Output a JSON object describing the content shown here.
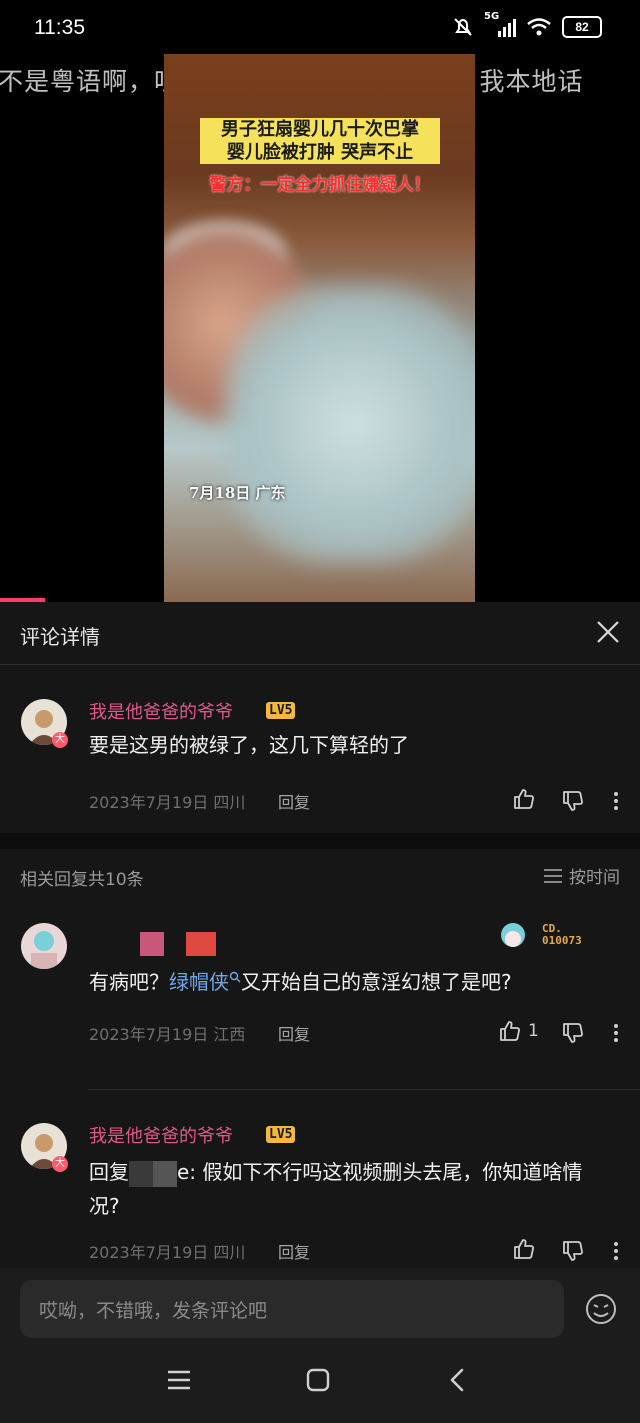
{
  "status_bar": {
    "time": "11:35",
    "signal_label": "5G",
    "battery": "82"
  },
  "danmaku": "不是粤语啊，听不懂别乱说行不行大哥。。我本地话",
  "video": {
    "caption_line1": "男子狂扇婴儿几十次巴掌",
    "caption_line2": "婴儿脸被打肿 哭声不止",
    "caption_police": "警方：一定全力抓住嫌疑人！",
    "dateline": "7月18日 广东"
  },
  "panel": {
    "title": "评论详情"
  },
  "main_comment": {
    "username": "我是他爸爸的爷爷",
    "level": "LV5",
    "text": "要是这男的被绿了，这几下算轻的了",
    "date_location": "2023年7月19日 四川",
    "reply_label": "回复"
  },
  "replies_header": {
    "count": "相关回复共10条",
    "sort": "按时间"
  },
  "reply1": {
    "badge_text": "CD. 010073",
    "text_before": "有病吧？",
    "link_text": "绿帽侠",
    "text_after": "又开始自己的意淫幻想了是吧?",
    "date_location": "2023年7月19日 江西",
    "reply_label": "回复",
    "likes": "1"
  },
  "reply2": {
    "username": "我是他爸爸的爷爷",
    "level": "LV5",
    "reply_prefix": "回复",
    "text": "e: 假如下不行吗这视频删头去尾，你知道啥情况?",
    "date_location": "2023年7月19日 四川",
    "reply_label": "回复"
  },
  "input": {
    "placeholder": "哎呦，不错哦，发条评论吧"
  },
  "colors": {
    "accent_pink": "#e0578a",
    "level_badge": "#f5b83d",
    "link_blue": "#6fa7e8",
    "progress": "#ff3b6b"
  }
}
